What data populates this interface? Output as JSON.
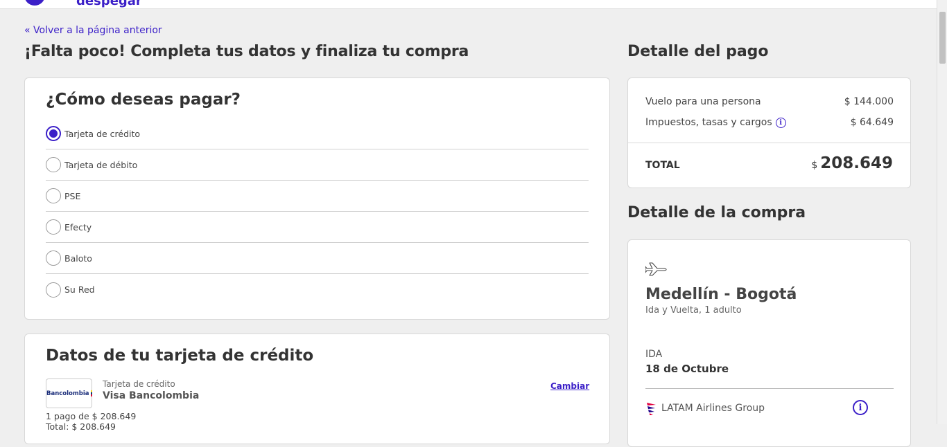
{
  "brand": {
    "logo_text": "despegar",
    "accent": "#3b1fc8"
  },
  "nav": {
    "back_link": "« Volver a la página anterior"
  },
  "page": {
    "title": "¡Falta poco! Completa tus datos y finaliza tu compra"
  },
  "payment": {
    "title": "¿Cómo deseas pagar?",
    "selected": "Tarjeta de crédito",
    "methods": [
      {
        "label": "Tarjeta de crédito",
        "checked": true
      },
      {
        "label": "Tarjeta de débito",
        "checked": false
      },
      {
        "label": "PSE",
        "checked": false
      },
      {
        "label": "Efecty",
        "checked": false
      },
      {
        "label": "Baloto",
        "checked": false
      },
      {
        "label": "Su Red",
        "checked": false
      }
    ]
  },
  "card_data": {
    "title": "Datos de tu tarjeta de crédito",
    "bank_logo_text": "Bancolombia",
    "card_type": "Tarjeta de crédito",
    "card_name": "Visa Bancolombia",
    "change_label": "Cambiar",
    "installments": "1 pago de $ 208.649",
    "total_text": "Total: $ 208.649"
  },
  "payment_detail": {
    "title": "Detalle del pago",
    "rows": [
      {
        "label": "Vuelo para una persona",
        "value": "$ 144.000"
      },
      {
        "label": "Impuestos, tasas y cargos",
        "value": "$ 64.649",
        "info_icon": "info-icon"
      }
    ],
    "total_label": "TOTAL",
    "total_currency": "$",
    "total_value": "208.649"
  },
  "purchase_detail": {
    "title": "Detalle de la compra",
    "icon": "airplane-icon",
    "route": "Medellín - Bogotá",
    "route_sub": "Ida y Vuelta, 1 adulto",
    "leg_label": "IDA",
    "leg_date": "18 de Octubre",
    "airline": "LATAM Airlines Group",
    "info_icon": "info-icon"
  }
}
